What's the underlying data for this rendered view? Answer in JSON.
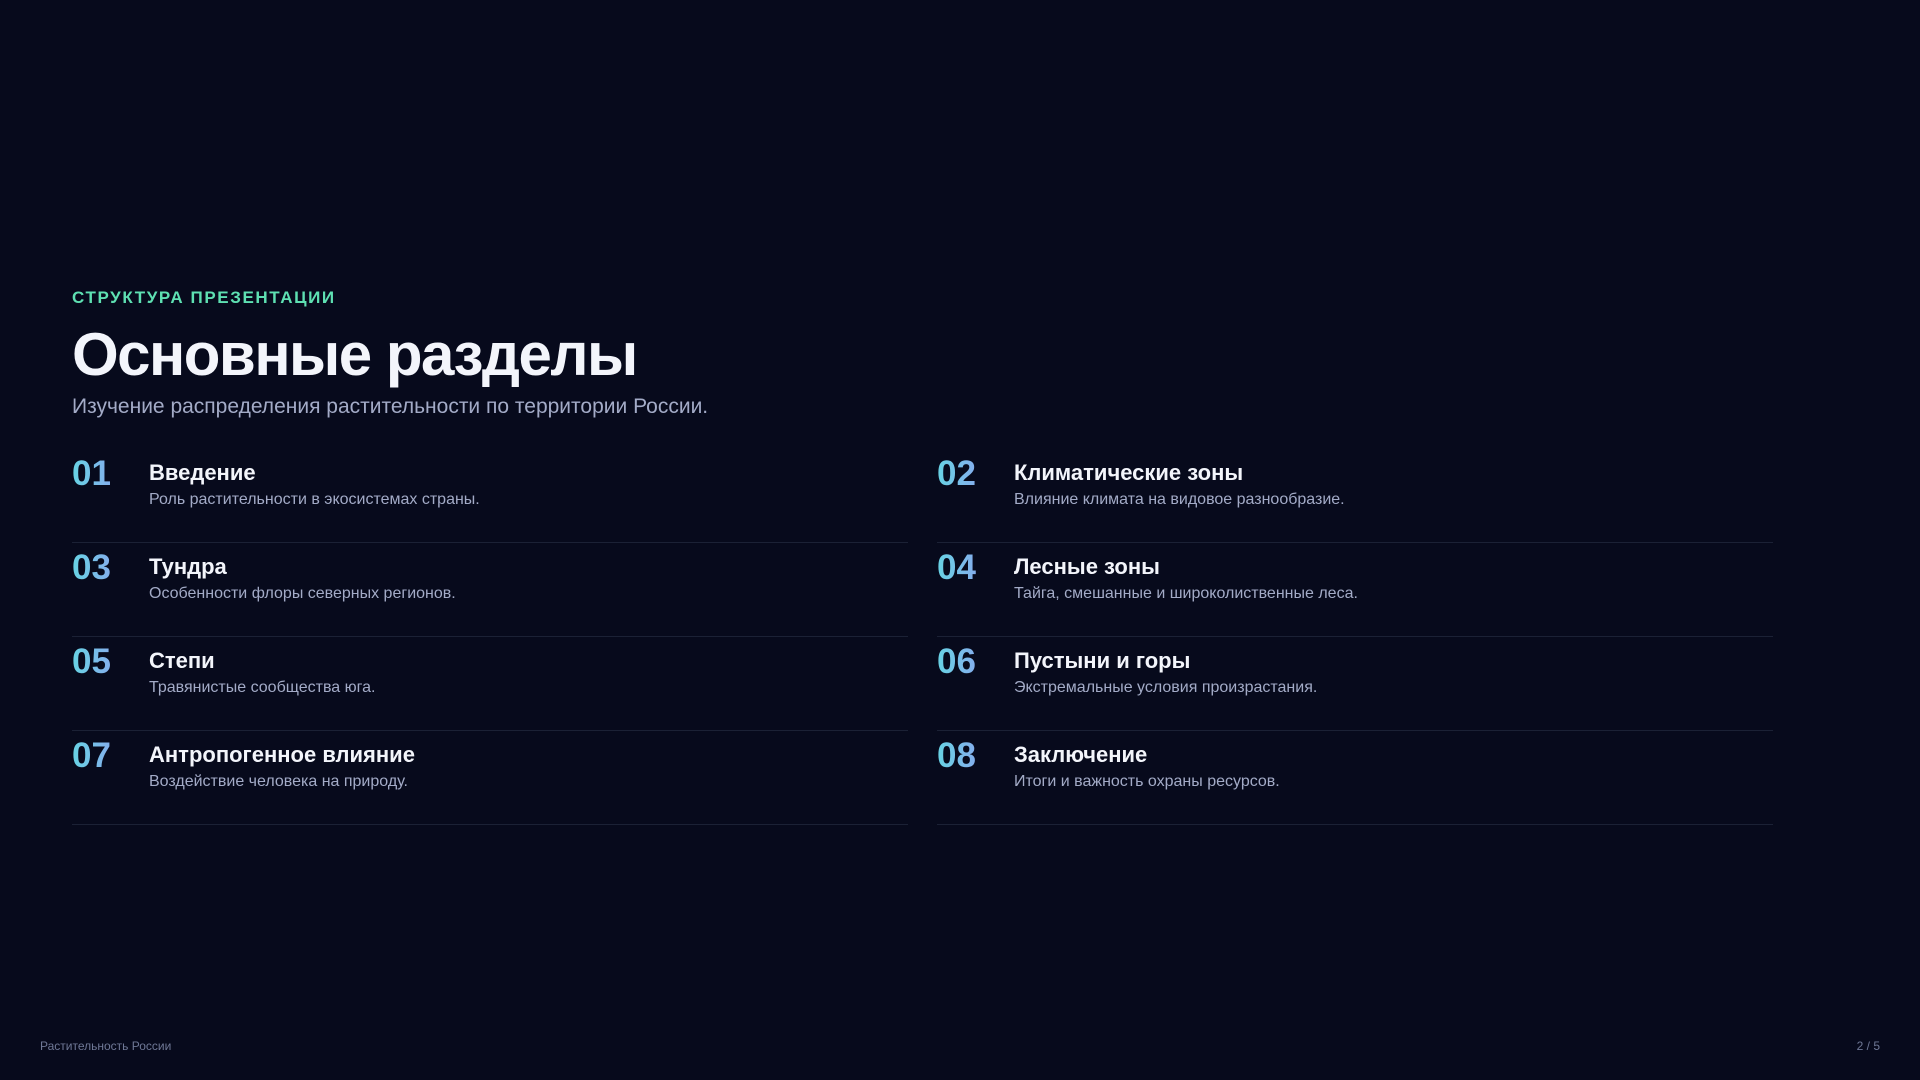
{
  "header": {
    "eyebrow": "СТРУКТУРА ПРЕЗЕНТАЦИИ",
    "title": "Основные разделы",
    "subtitle": "Изучение распределения растительности по территории России."
  },
  "sections": [
    {
      "number": "01",
      "title": "Введение",
      "description": "Роль растительности в экосистемах страны."
    },
    {
      "number": "02",
      "title": "Климатические зоны",
      "description": "Влияние климата на видовое разнообразие."
    },
    {
      "number": "03",
      "title": "Тундра",
      "description": "Особенности флоры северных регионов."
    },
    {
      "number": "04",
      "title": "Лесные зоны",
      "description": "Тайга, смешанные и широколиственные леса."
    },
    {
      "number": "05",
      "title": "Степи",
      "description": "Травянистые сообщества юга."
    },
    {
      "number": "06",
      "title": "Пустыни и горы",
      "description": "Экстремальные условия произрастания."
    },
    {
      "number": "07",
      "title": "Антропогенное влияние",
      "description": "Воздействие человека на природу."
    },
    {
      "number": "08",
      "title": "Заключение",
      "description": "Итоги и важность охраны ресурсов."
    }
  ],
  "footer": {
    "presentation_title": "Растительность России",
    "page_indicator": "2 / 5"
  },
  "colors": {
    "background": "#070a1c",
    "accent_green": "#5ee0b2",
    "number_gradient_start": "#67d3e4",
    "number_gradient_end": "#a08cf5"
  }
}
